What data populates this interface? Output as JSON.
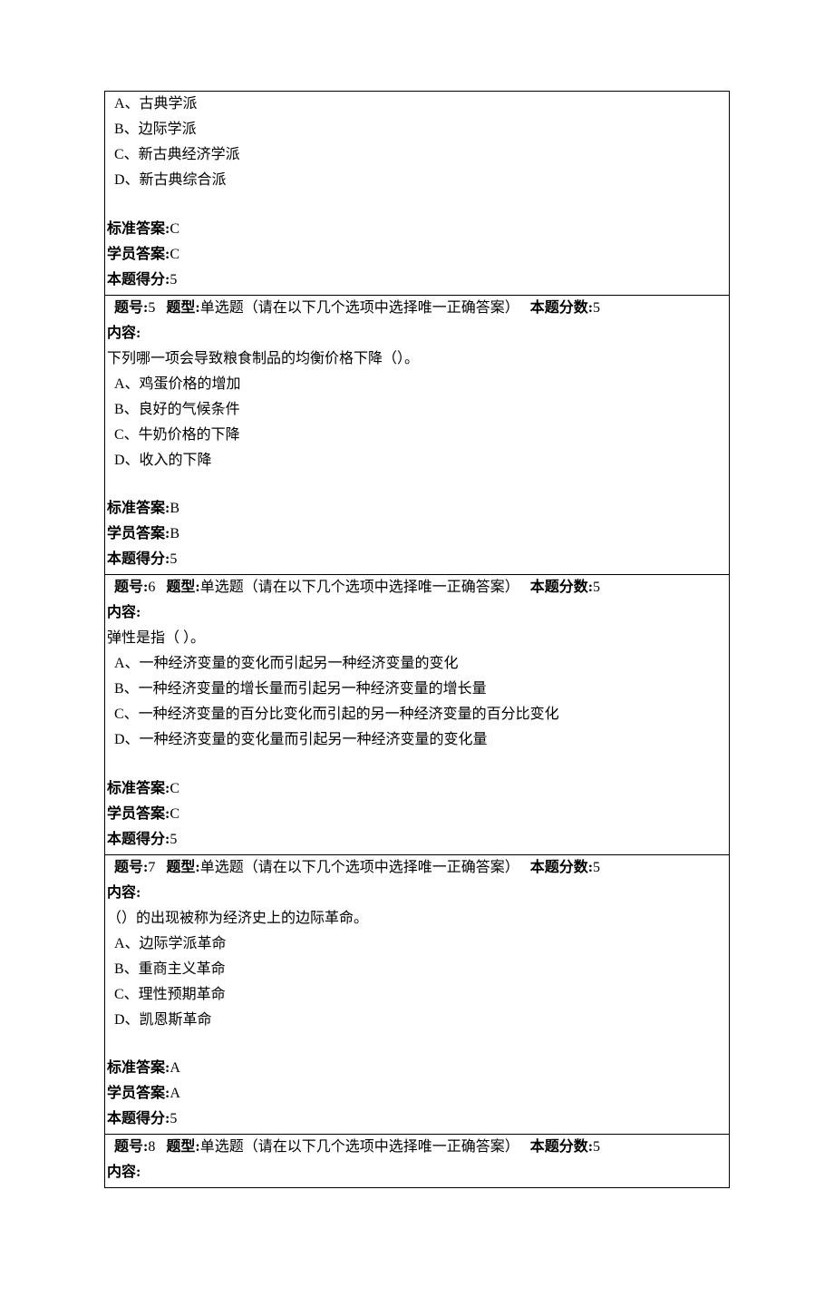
{
  "labels": {
    "question_no": "题号:",
    "type": "题型:",
    "points": "本题分数:",
    "content": "内容:",
    "std_answer": "标准答案:",
    "stu_answer": "学员答案:",
    "earned": "本题得分:"
  },
  "type_text": "单选题（请在以下几个选项中选择唯一正确答案）",
  "q4_tail": {
    "options": [
      "A、古典学派",
      "B、边际学派",
      "C、新古典经济学派",
      "D、新古典综合派"
    ],
    "std_answer": "C",
    "stu_answer": "C",
    "earned": "5"
  },
  "q5": {
    "no": "5",
    "points": "5",
    "stem": "下列哪一项会导致粮食制品的均衡价格下降（）。",
    "options": [
      "A、鸡蛋价格的增加",
      "B、良好的气候条件",
      "C、牛奶价格的下降",
      "D、收入的下降"
    ],
    "std_answer": "B",
    "stu_answer": "B",
    "earned": "5"
  },
  "q6": {
    "no": "6",
    "points": "5",
    "stem": "弹性是指（ ）。",
    "options": [
      "A、一种经济变量的变化而引起另一种经济变量的变化",
      "B、一种经济变量的增长量而引起另一种经济变量的增长量",
      "C、一种经济变量的百分比变化而引起的另一种经济变量的百分比变化",
      "D、一种经济变量的变化量而引起另一种经济变量的变化量"
    ],
    "std_answer": "C",
    "stu_answer": "C",
    "earned": "5"
  },
  "q7": {
    "no": "7",
    "points": "5",
    "stem": "（）的出现被称为经济史上的边际革命。",
    "options": [
      "A、边际学派革命",
      "B、重商主义革命",
      "C、理性预期革命",
      "D、凯恩斯革命"
    ],
    "std_answer": "A",
    "stu_answer": "A",
    "earned": "5"
  },
  "q8": {
    "no": "8",
    "points": "5"
  }
}
